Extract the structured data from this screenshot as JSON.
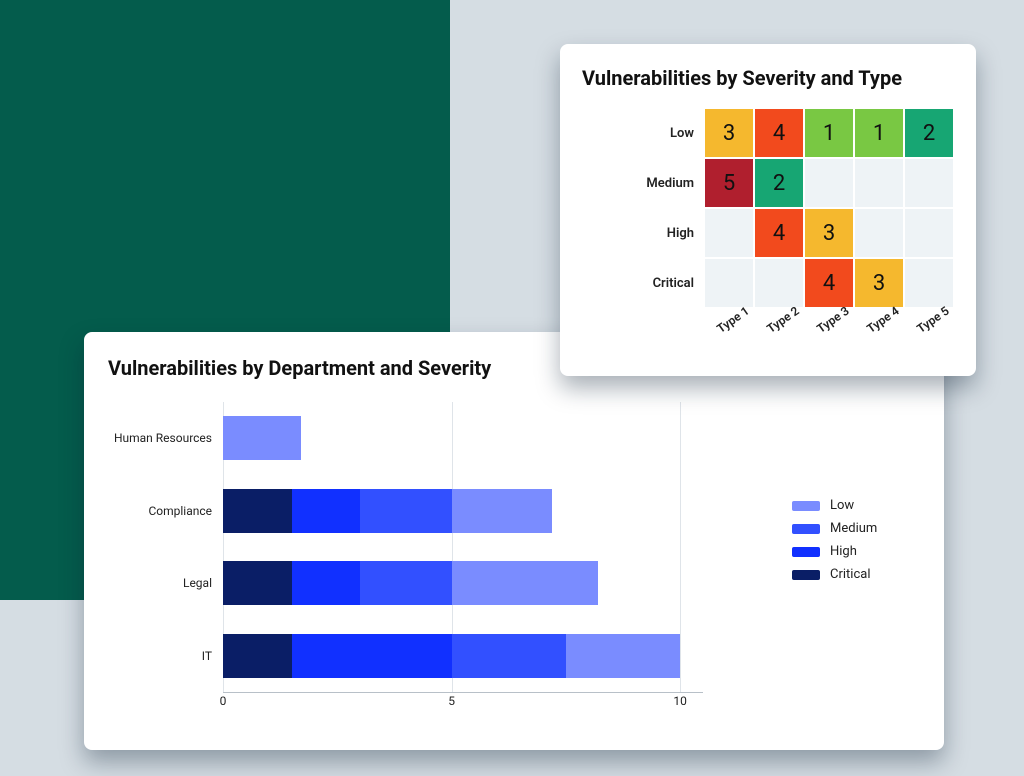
{
  "chart_data": [
    {
      "id": "heatmap",
      "type": "heatmap",
      "title": "Vulnerabilities by Severity and Type",
      "x_labels": [
        "Type 1",
        "Type 2",
        "Type 3",
        "Type 4",
        "Type 5"
      ],
      "y_labels": [
        "Low",
        "Medium",
        "High",
        "Critical"
      ],
      "cells": [
        [
          {
            "value": 3,
            "color": "#f5b82e"
          },
          {
            "value": 4,
            "color": "#f24a1d"
          },
          {
            "value": 1,
            "color": "#79c843"
          },
          {
            "value": 1,
            "color": "#79c843"
          },
          {
            "value": 2,
            "color": "#17a673"
          }
        ],
        [
          {
            "value": 5,
            "color": "#b01f2e"
          },
          {
            "value": 2,
            "color": "#17a673"
          },
          {
            "value": null,
            "color": null
          },
          {
            "value": null,
            "color": null
          },
          {
            "value": null,
            "color": null
          }
        ],
        [
          {
            "value": null,
            "color": null
          },
          {
            "value": 4,
            "color": "#f24a1d"
          },
          {
            "value": 3,
            "color": "#f5b82e"
          },
          {
            "value": null,
            "color": null
          },
          {
            "value": null,
            "color": null
          }
        ],
        [
          {
            "value": null,
            "color": null
          },
          {
            "value": null,
            "color": null
          },
          {
            "value": 4,
            "color": "#f24a1d"
          },
          {
            "value": 3,
            "color": "#f5b82e"
          },
          {
            "value": null,
            "color": null
          }
        ]
      ]
    },
    {
      "id": "stacked_bar",
      "type": "bar",
      "orientation": "horizontal",
      "stacked": true,
      "title": "Vulnerabilities by Department and Severity",
      "xlim": [
        0,
        10.5
      ],
      "x_ticks": [
        0,
        5,
        10
      ],
      "categories": [
        "Human Resources",
        "Compliance",
        "Legal",
        "IT"
      ],
      "series": [
        {
          "name": "Critical",
          "color": "#0a1e66",
          "values": [
            0.0,
            1.5,
            1.5,
            1.5
          ]
        },
        {
          "name": "High",
          "color": "#1130ff",
          "values": [
            0.0,
            1.5,
            1.5,
            3.5
          ]
        },
        {
          "name": "Medium",
          "color": "#3250ff",
          "values": [
            0.0,
            2.0,
            2.0,
            2.5
          ]
        },
        {
          "name": "Low",
          "color": "#7a8cff",
          "values": [
            1.7,
            2.2,
            3.2,
            2.5
          ]
        }
      ],
      "legend_order": [
        "Low",
        "Medium",
        "High",
        "Critical"
      ]
    }
  ]
}
